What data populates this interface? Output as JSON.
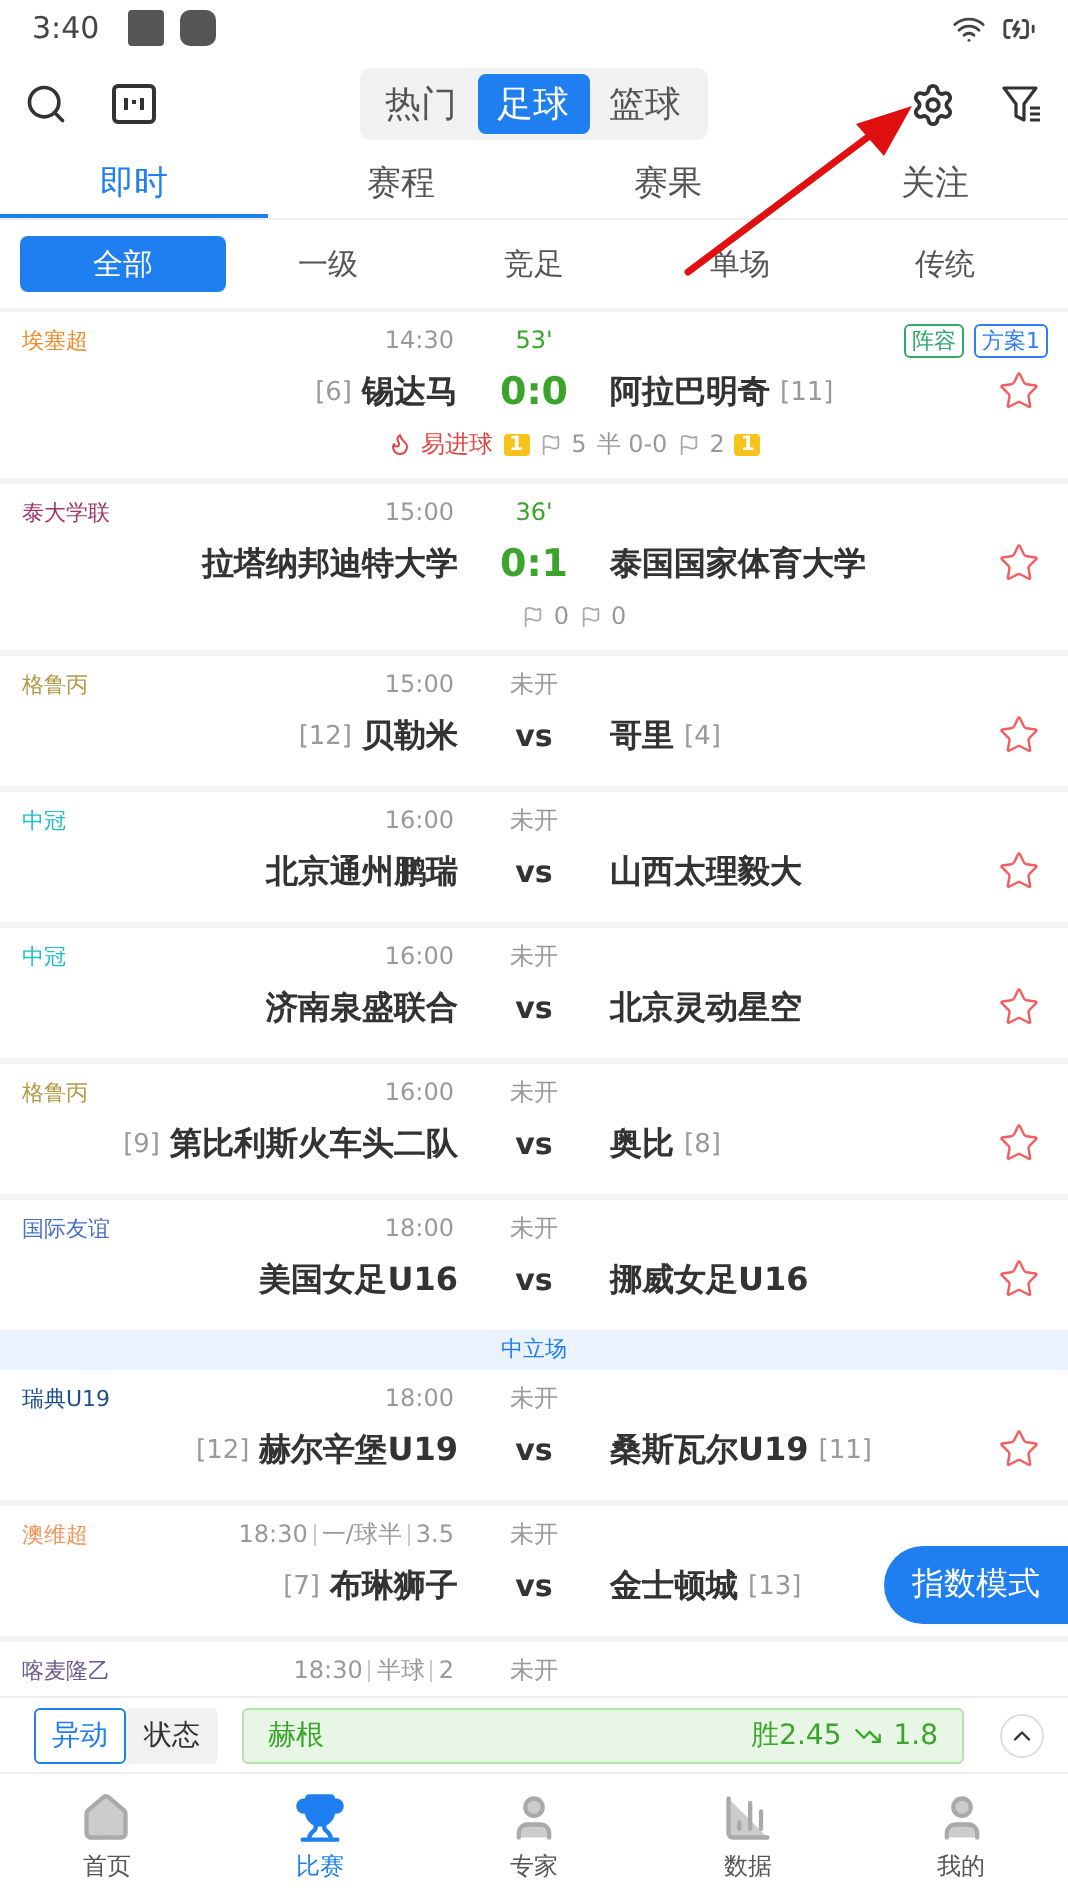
{
  "status_bar": {
    "time": "3:40"
  },
  "sport_tabs": [
    {
      "label": "热门",
      "selected": false
    },
    {
      "label": "足球",
      "selected": true
    },
    {
      "label": "篮球",
      "selected": false
    }
  ],
  "main_tabs": [
    {
      "label": "即时",
      "selected": true
    },
    {
      "label": "赛程",
      "selected": false
    },
    {
      "label": "赛果",
      "selected": false
    },
    {
      "label": "关注",
      "selected": false
    }
  ],
  "filters": [
    {
      "label": "全部",
      "selected": true
    },
    {
      "label": "一级",
      "selected": false
    },
    {
      "label": "竞足",
      "selected": false
    },
    {
      "label": "单场",
      "selected": false
    },
    {
      "label": "传统",
      "selected": false
    }
  ],
  "matches": [
    {
      "kind": "match",
      "league": "埃塞超",
      "color": "#f08a2a",
      "time": "14:30",
      "status": "53'",
      "live": true,
      "home_rank": "[6]",
      "home": "锡达马",
      "score": "0:0",
      "away": "阿拉巴明奇",
      "away_rank": "[11]",
      "tags": [
        {
          "label": "阵容",
          "color": "#2fa86a"
        },
        {
          "label": "方案1",
          "color": "#2f7ff0"
        }
      ],
      "starred": false,
      "stats": [
        {
          "kind": "hot",
          "text": "易进球"
        },
        {
          "kind": "card",
          "text": "1"
        },
        {
          "kind": "corner",
          "text": "5"
        },
        {
          "kind": "plain",
          "text": "半 0-0"
        },
        {
          "kind": "corner",
          "text": "2"
        },
        {
          "kind": "card",
          "text": "1"
        }
      ]
    },
    {
      "kind": "match",
      "league": "泰大学联",
      "color": "#a0356a",
      "time": "15:00",
      "status": "36'",
      "live": true,
      "home": "拉塔纳邦迪特大学",
      "score": "0:1",
      "away": "泰国国家体育大学",
      "starred": false,
      "stats": [
        {
          "kind": "corner",
          "text": "0"
        },
        {
          "kind": "corner",
          "text": "0"
        }
      ]
    },
    {
      "kind": "match",
      "league": "格鲁丙",
      "color": "#b09a45",
      "time": "15:00",
      "status": "未开",
      "live": false,
      "home_rank": "[12]",
      "home": "贝勒米",
      "score": "vs",
      "away": "哥里",
      "away_rank": "[4]",
      "starred": false
    },
    {
      "kind": "match",
      "league": "中冠",
      "color": "#1fbfc8",
      "time": "16:00",
      "status": "未开",
      "live": false,
      "home": "北京通州鹏瑞",
      "score": "vs",
      "away": "山西太理毅大",
      "starred": false
    },
    {
      "kind": "match",
      "league": "中冠",
      "color": "#1fbfc8",
      "time": "16:00",
      "status": "未开",
      "live": false,
      "home": "济南泉盛联合",
      "score": "vs",
      "away": "北京灵动星空",
      "starred": false
    },
    {
      "kind": "match",
      "league": "格鲁丙",
      "color": "#b09a45",
      "time": "16:00",
      "status": "未开",
      "live": false,
      "home_rank": "[9]",
      "home": "第比利斯火车头二队",
      "score": "vs",
      "away": "奥比",
      "away_rank": "[8]",
      "starred": false
    },
    {
      "kind": "match",
      "league": "国际友谊",
      "color": "#4a6fc8",
      "time": "18:00",
      "status": "未开",
      "live": false,
      "home": "美国女足U16",
      "score": "vs",
      "away": "挪威女足U16",
      "starred": false
    },
    {
      "kind": "divider",
      "label": "中立场"
    },
    {
      "kind": "match",
      "league": "瑞典U19",
      "color": "#1e4f8a",
      "time": "18:00",
      "status": "未开",
      "live": false,
      "home_rank": "[12]",
      "home": "赫尔辛堡U19",
      "score": "vs",
      "away": "桑斯瓦尔U19",
      "away_rank": "[11]",
      "starred": false
    },
    {
      "kind": "match",
      "league": "澳维超",
      "color": "#f5935a",
      "time": "18:30",
      "odds": [
        "一/球半",
        "3.5"
      ],
      "status": "未开",
      "live": false,
      "home_rank": "[7]",
      "home": "布琳狮子",
      "score": "vs",
      "away": "金士顿城",
      "away_rank": "[13]"
    },
    {
      "kind": "match",
      "league": "喀麦隆乙",
      "color": "#6a5a8a",
      "time": "18:30",
      "odds": [
        "半球",
        "2"
      ],
      "status": "未开",
      "live": false
    }
  ],
  "float_button": "指数模式",
  "ticker": {
    "tabs": [
      {
        "label": "异动",
        "selected": true
      },
      {
        "label": "状态",
        "selected": false
      }
    ],
    "team": "赫根",
    "odds_from": "胜2.45",
    "odds_to": "1.8"
  },
  "nav": [
    {
      "label": "首页",
      "selected": false
    },
    {
      "label": "比赛",
      "selected": true
    },
    {
      "label": "专家",
      "selected": false
    },
    {
      "label": "数据",
      "selected": false
    },
    {
      "label": "我的",
      "selected": false
    }
  ]
}
